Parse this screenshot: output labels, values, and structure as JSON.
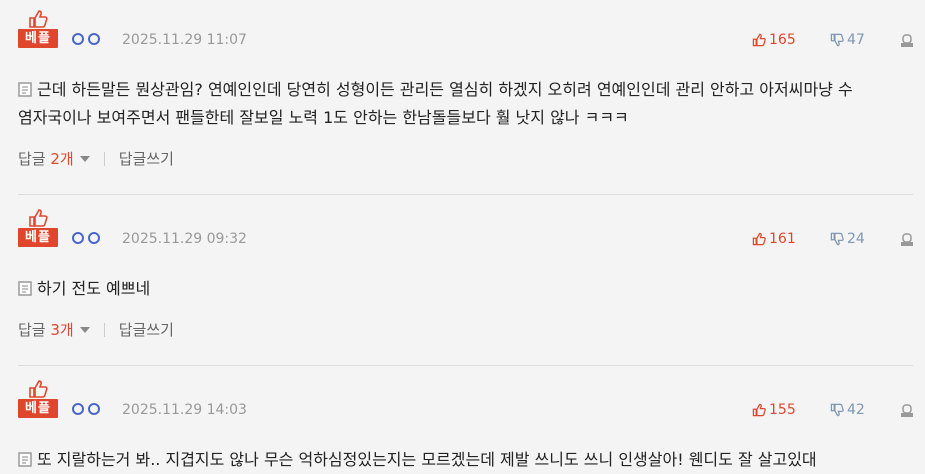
{
  "comments": [
    {
      "badge": "베플",
      "date": "2025.11.29 11:07",
      "up": "165",
      "down": "47",
      "text_line1": "근데 하든말든 뭔상관임? 연예인인데 당연히 성형이든 관리든 열심히 하겠지 오히려 연예인인데 관리 안하고 아저씨마냥 수",
      "text_line2": "염자국이나 보여주면서 팬들한테 잘보일 노력 1도 안하는 한남돌들보다 훨 낫지 않나 ㅋㅋㅋ",
      "reply_prefix": "답글 ",
      "reply_count": "2개",
      "write_reply": "답글쓰기"
    },
    {
      "badge": "베플",
      "date": "2025.11.29 09:32",
      "up": "161",
      "down": "24",
      "text_line1": "하기 전도 예쁘네",
      "reply_prefix": "답글 ",
      "reply_count": "3개",
      "write_reply": "답글쓰기"
    },
    {
      "badge": "베플",
      "date": "2025.11.29 14:03",
      "up": "155",
      "down": "42",
      "text_line1": "또 지랄하는거 봐.. 지겹지도 않나 무슨 억하심정있는지는 모르겠는데 제발 쓰니도 쓰니 인생살아! 웬디도 잘 살고있대"
    }
  ],
  "colors": {
    "accent": "#e0462e",
    "down": "#7d97b4",
    "author": "#4a66c8",
    "background": "#f4f4f4"
  },
  "icons": {
    "best": "thumb-up-icon",
    "up": "thumb-up-icon",
    "down": "thumb-down-icon",
    "report": "report-icon",
    "text": "document-icon"
  }
}
